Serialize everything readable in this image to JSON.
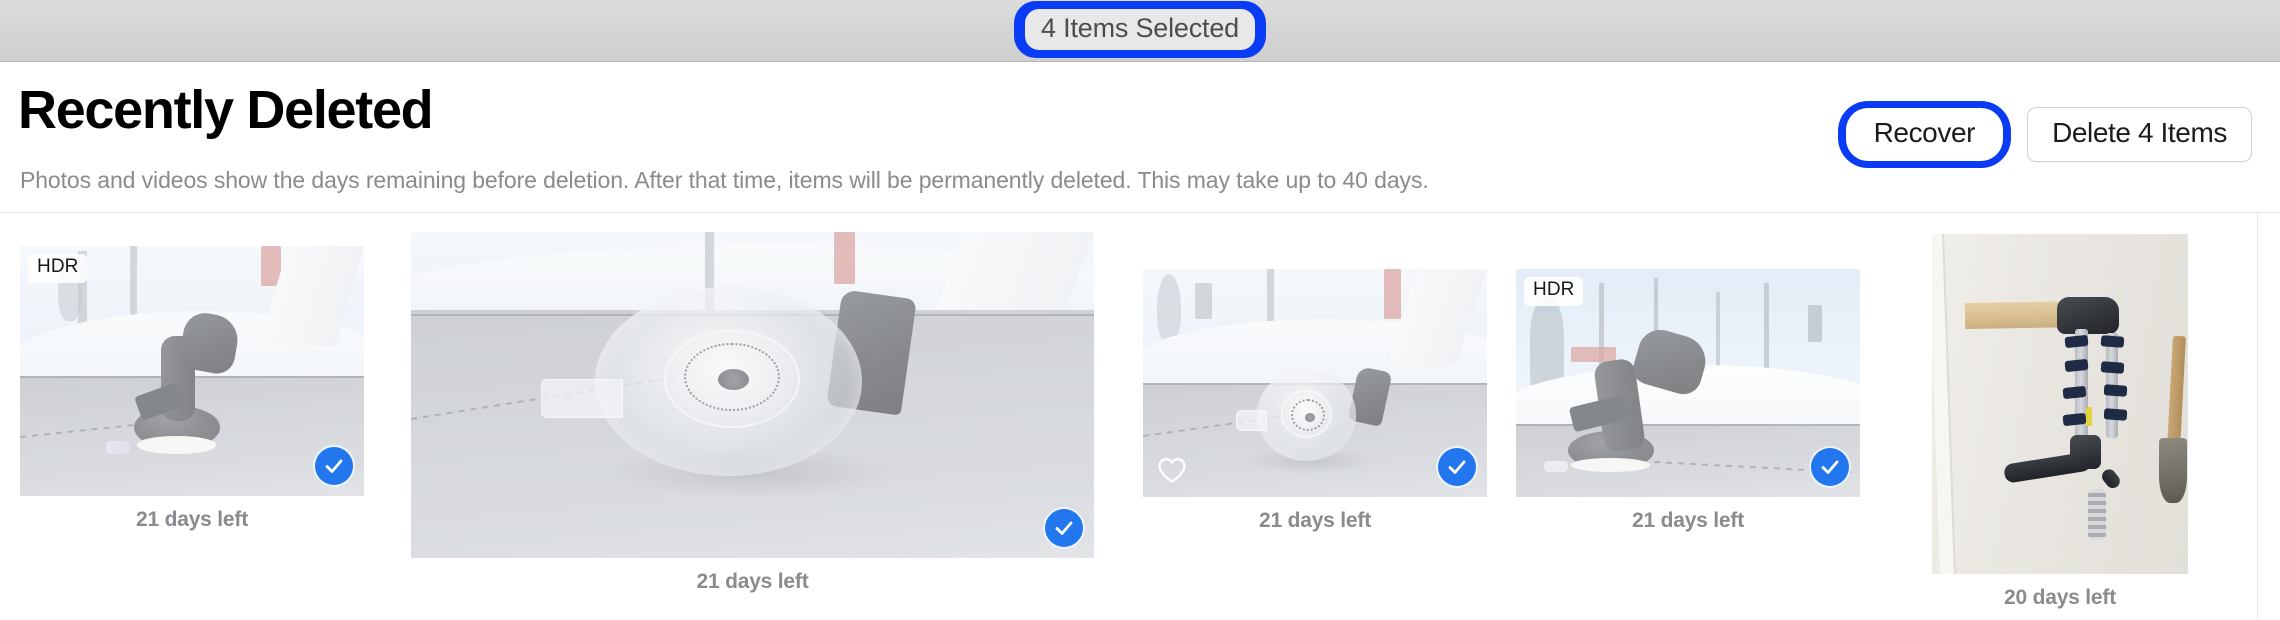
{
  "titlebar": {
    "selection_status": "4 Items Selected",
    "focus_ring_color": "#0b3cf5"
  },
  "header": {
    "title": "Recently Deleted",
    "subtitle": "Photos and videos show the days remaining before deletion. After that time, items will be permanently deleted. This may take up to 40 days.",
    "actions": {
      "recover_label": "Recover",
      "delete_label": "Delete 4 Items"
    }
  },
  "grid": {
    "items": [
      {
        "id": "photo-1",
        "caption": "21 days left",
        "hdr_badge": "HDR",
        "selected": true,
        "favorite": false,
        "scene": "dashboard-mount-wide",
        "orientation": "landscape"
      },
      {
        "id": "photo-2",
        "caption": "21 days left",
        "hdr_badge": "",
        "selected": true,
        "favorite": false,
        "scene": "suction-cup-closeup",
        "orientation": "landscape-large"
      },
      {
        "id": "photo-3",
        "caption": "21 days left",
        "hdr_badge": "",
        "selected": true,
        "favorite": true,
        "scene": "suction-cup-dashboard",
        "orientation": "landscape"
      },
      {
        "id": "photo-4",
        "caption": "21 days left",
        "hdr_badge": "HDR",
        "selected": true,
        "favorite": false,
        "scene": "dashboard-mount-trees",
        "orientation": "landscape"
      },
      {
        "id": "photo-5",
        "caption": "20 days left",
        "hdr_badge": "",
        "selected": false,
        "favorite": false,
        "scene": "garage-wall-rack",
        "orientation": "portrait"
      }
    ]
  },
  "colors": {
    "accent_blue": "#2276ee",
    "focus_blue": "#0b3cf5",
    "caption_gray": "#8a8a8f",
    "titlebar_gray": "#d6d6d6"
  }
}
